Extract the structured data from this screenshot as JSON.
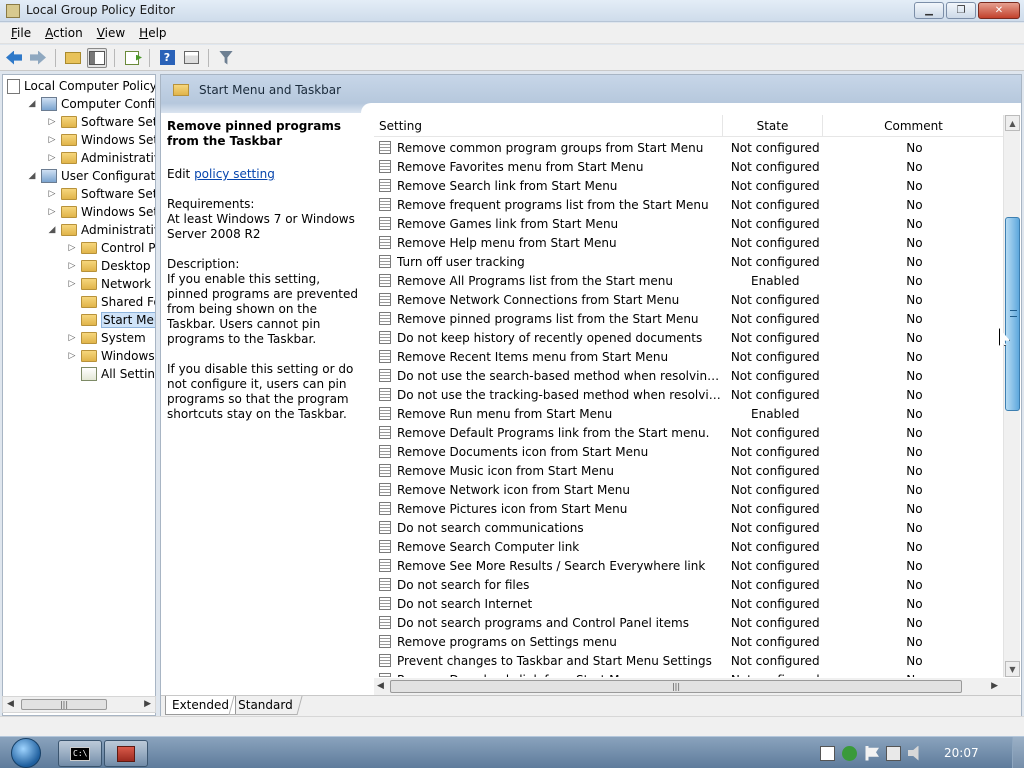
{
  "window": {
    "title": "Local Group Policy Editor"
  },
  "menu": [
    {
      "label": "File",
      "accel": "F",
      "rest": "ile"
    },
    {
      "label": "Action",
      "accel": "A",
      "rest": "ction"
    },
    {
      "label": "View",
      "accel": "V",
      "rest": "iew"
    },
    {
      "label": "Help",
      "accel": "H",
      "rest": "elp"
    }
  ],
  "toolbar": {
    "icons": [
      "back-arrow-icon",
      "forward-arrow-icon",
      "up-folder-icon",
      "show-hide-tree-icon",
      "export-list-icon",
      "help-icon",
      "properties-icon",
      "filter-icon"
    ],
    "help_glyph": "?"
  },
  "tree": {
    "items": [
      {
        "label": "Local Computer Policy",
        "indent": 0,
        "twisty": "",
        "icon": "policy-doc-icon"
      },
      {
        "label": "Computer Configuration",
        "indent": 1,
        "twisty": "◢",
        "icon": "computer-icon"
      },
      {
        "label": "Software Settings",
        "indent": 2,
        "twisty": "▷",
        "icon": "folder-icon"
      },
      {
        "label": "Windows Settings",
        "indent": 2,
        "twisty": "▷",
        "icon": "folder-icon"
      },
      {
        "label": "Administrative Templates",
        "indent": 2,
        "twisty": "▷",
        "icon": "folder-icon"
      },
      {
        "label": "User Configuration",
        "indent": 1,
        "twisty": "◢",
        "icon": "computer-icon"
      },
      {
        "label": "Software Settings",
        "indent": 2,
        "twisty": "▷",
        "icon": "folder-icon"
      },
      {
        "label": "Windows Settings",
        "indent": 2,
        "twisty": "▷",
        "icon": "folder-icon"
      },
      {
        "label": "Administrative Templates",
        "indent": 2,
        "twisty": "◢",
        "icon": "folder-icon"
      },
      {
        "label": "Control Panel",
        "indent": 3,
        "twisty": "▷",
        "icon": "folder-icon"
      },
      {
        "label": "Desktop",
        "indent": 3,
        "twisty": "▷",
        "icon": "folder-icon"
      },
      {
        "label": "Network",
        "indent": 3,
        "twisty": "▷",
        "icon": "folder-icon"
      },
      {
        "label": "Shared Folders",
        "indent": 3,
        "twisty": "",
        "icon": "folder-icon"
      },
      {
        "label": "Start Menu and Taskbar",
        "indent": 3,
        "twisty": "",
        "icon": "folder-icon",
        "selected": true
      },
      {
        "label": "System",
        "indent": 3,
        "twisty": "▷",
        "icon": "folder-icon"
      },
      {
        "label": "Windows Components",
        "indent": 3,
        "twisty": "▷",
        "icon": "folder-icon"
      },
      {
        "label": "All Settings",
        "indent": 3,
        "twisty": "",
        "icon": "all-settings-icon"
      }
    ]
  },
  "section": {
    "title": "Start Menu and Taskbar"
  },
  "description": {
    "heading": "Remove pinned programs from the Taskbar",
    "edit_prefix": "Edit ",
    "edit_link": "policy setting",
    "requirements_label": "Requirements:",
    "requirements_text": "At least Windows 7 or Windows Server 2008 R2",
    "description_label": "Description:",
    "para1": "If you enable this setting, pinned programs are prevented from being shown on the Taskbar. Users cannot pin programs to the Taskbar.",
    "para2": "If you disable this setting or do not configure it, users can pin programs so that the program shortcuts stay on the Taskbar."
  },
  "table": {
    "columns": {
      "setting": "Setting",
      "state": "State",
      "comment": "Comment"
    },
    "rows": [
      {
        "setting": "Remove common program groups from Start Menu",
        "state": "Not configured",
        "comment": "No"
      },
      {
        "setting": "Remove Favorites menu from Start Menu",
        "state": "Not configured",
        "comment": "No"
      },
      {
        "setting": "Remove Search link from Start Menu",
        "state": "Not configured",
        "comment": "No"
      },
      {
        "setting": "Remove frequent programs list from the Start Menu",
        "state": "Not configured",
        "comment": "No"
      },
      {
        "setting": "Remove Games link from Start Menu",
        "state": "Not configured",
        "comment": "No"
      },
      {
        "setting": "Remove Help menu from Start Menu",
        "state": "Not configured",
        "comment": "No"
      },
      {
        "setting": "Turn off user tracking",
        "state": "Not configured",
        "comment": "No"
      },
      {
        "setting": "Remove All Programs list from the Start menu",
        "state": "Enabled",
        "comment": "No"
      },
      {
        "setting": "Remove Network Connections from Start Menu",
        "state": "Not configured",
        "comment": "No"
      },
      {
        "setting": "Remove pinned programs list from the Start Menu",
        "state": "Not configured",
        "comment": "No"
      },
      {
        "setting": "Do not keep history of recently opened documents",
        "state": "Not configured",
        "comment": "No"
      },
      {
        "setting": "Remove Recent Items menu from Start Menu",
        "state": "Not configured",
        "comment": "No"
      },
      {
        "setting": "Do not use the search-based method when resolving shell s...",
        "state": "Not configured",
        "comment": "No"
      },
      {
        "setting": "Do not use the tracking-based method when resolving shell ...",
        "state": "Not configured",
        "comment": "No"
      },
      {
        "setting": "Remove Run menu from Start Menu",
        "state": "Enabled",
        "comment": "No"
      },
      {
        "setting": "Remove Default Programs link from the Start menu.",
        "state": "Not configured",
        "comment": "No"
      },
      {
        "setting": "Remove Documents icon from Start Menu",
        "state": "Not configured",
        "comment": "No"
      },
      {
        "setting": "Remove Music icon from Start Menu",
        "state": "Not configured",
        "comment": "No"
      },
      {
        "setting": "Remove Network icon from Start Menu",
        "state": "Not configured",
        "comment": "No"
      },
      {
        "setting": "Remove Pictures icon from Start Menu",
        "state": "Not configured",
        "comment": "No"
      },
      {
        "setting": "Do not search communications",
        "state": "Not configured",
        "comment": "No"
      },
      {
        "setting": "Remove Search Computer link",
        "state": "Not configured",
        "comment": "No"
      },
      {
        "setting": "Remove See More Results / Search Everywhere link",
        "state": "Not configured",
        "comment": "No"
      },
      {
        "setting": "Do not search for files",
        "state": "Not configured",
        "comment": "No"
      },
      {
        "setting": "Do not search Internet",
        "state": "Not configured",
        "comment": "No"
      },
      {
        "setting": "Do not search programs and Control Panel items",
        "state": "Not configured",
        "comment": "No"
      },
      {
        "setting": "Remove programs on Settings menu",
        "state": "Not configured",
        "comment": "No"
      },
      {
        "setting": "Prevent changes to Taskbar and Start Menu Settings",
        "state": "Not configured",
        "comment": "No"
      },
      {
        "setting": "Remove Downloads link from Start Menu",
        "state": "Not configured",
        "comment": "No"
      }
    ]
  },
  "tabs": {
    "extended": "Extended",
    "standard": "Standard"
  },
  "taskbar": {
    "cmd_glyph": "C:\\",
    "clock": "20:07"
  }
}
